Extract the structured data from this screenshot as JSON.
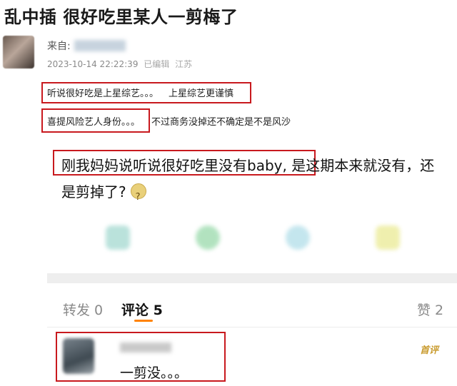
{
  "headline": "乱中插 很好吃里某人一剪梅了",
  "post": {
    "from_label": "来自:",
    "timestamp": "2023-10-14 22:22:39",
    "edited": "已编辑",
    "location": "江苏",
    "lines": [
      {
        "text": "听说很好吃是上星综艺。。。",
        "after": "上星综艺更谨慎"
      },
      {
        "text": "喜提风险艺人身份。。。",
        "after": "不过商务没掉还不确定是不是风沙"
      }
    ],
    "main_highlight": "刚我妈妈说听说很好吃里没有baby,",
    "main_rest": "是这期本来就没有，还是剪掉了?"
  },
  "tabs": {
    "repost": "转发 0",
    "comment": "评论 5",
    "like": "赞 2"
  },
  "comment": {
    "text": "一剪没。。。",
    "badge": "首评"
  },
  "colors": {
    "highlight_box": "#c8191e",
    "tab_underline": "#ff8200",
    "badge": "#c99b2e"
  }
}
